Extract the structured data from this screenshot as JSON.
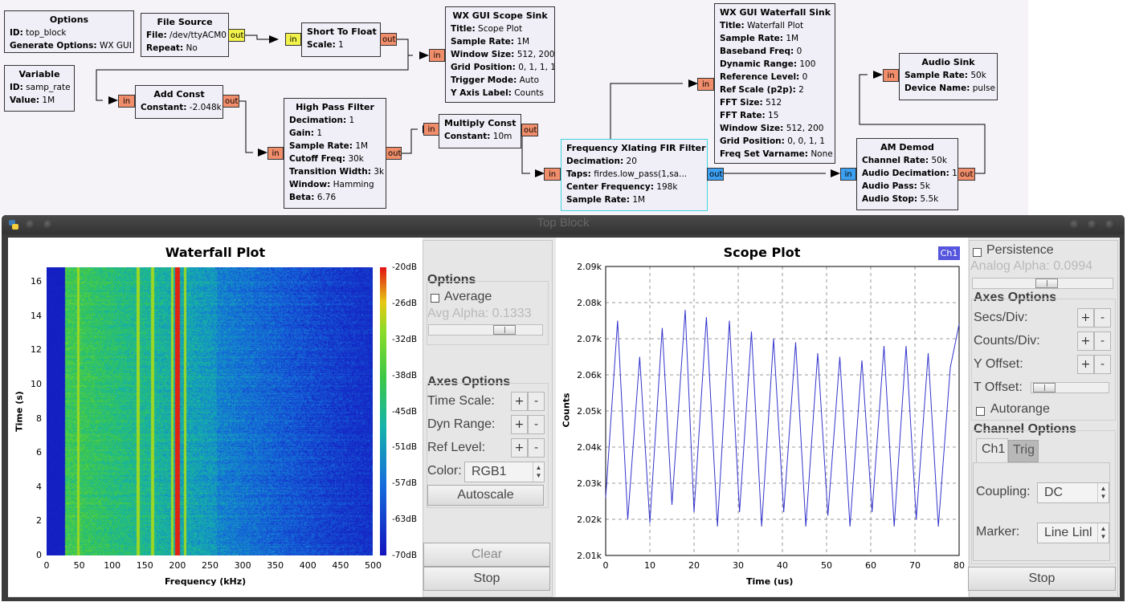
{
  "flowgraph": {
    "blocks": {
      "options": {
        "title": "Options",
        "rows": [
          [
            "ID:",
            "top_block"
          ],
          [
            "Generate Options:",
            "WX GUI"
          ]
        ]
      },
      "variable": {
        "title": "Variable",
        "rows": [
          [
            "ID:",
            "samp_rate"
          ],
          [
            "Value:",
            "1M"
          ]
        ]
      },
      "file_source": {
        "title": "File Source",
        "rows": [
          [
            "File:",
            "/dev/ttyACM0"
          ],
          [
            "Repeat:",
            "No"
          ]
        ]
      },
      "short_to_float": {
        "title": "Short To Float",
        "rows": [
          [
            "Scale:",
            "1"
          ]
        ]
      },
      "add_const": {
        "title": "Add Const",
        "rows": [
          [
            "Constant:",
            "-2.048k"
          ]
        ]
      },
      "scope_sink": {
        "title": "WX GUI Scope Sink",
        "rows": [
          [
            "Title:",
            "Scope Plot"
          ],
          [
            "Sample Rate:",
            "1M"
          ],
          [
            "Window Size:",
            "512, 200"
          ],
          [
            "Grid Position:",
            "0, 1, 1, 1"
          ],
          [
            "Trigger Mode:",
            "Auto"
          ],
          [
            "Y Axis Label:",
            "Counts"
          ]
        ]
      },
      "high_pass": {
        "title": "High Pass Filter",
        "rows": [
          [
            "Decimation:",
            "1"
          ],
          [
            "Gain:",
            "1"
          ],
          [
            "Sample Rate:",
            "1M"
          ],
          [
            "Cutoff Freq:",
            "30k"
          ],
          [
            "Transition Width:",
            "3k"
          ],
          [
            "Window:",
            "Hamming"
          ],
          [
            "Beta:",
            "6.76"
          ]
        ]
      },
      "multiply_const": {
        "title": "Multiply Const",
        "rows": [
          [
            "Constant:",
            "10m"
          ]
        ]
      },
      "xlating": {
        "title": "Frequency Xlating FIR Filter",
        "rows": [
          [
            "Decimation:",
            "20"
          ],
          [
            "Taps:",
            "firdes.low_pass(1,sa..."
          ],
          [
            "Center Frequency:",
            "198k"
          ],
          [
            "Sample Rate:",
            "1M"
          ]
        ]
      },
      "waterfall_sink": {
        "title": "WX GUI Waterfall Sink",
        "rows": [
          [
            "Title:",
            "Waterfall Plot"
          ],
          [
            "Sample Rate:",
            "1M"
          ],
          [
            "Baseband Freq:",
            "0"
          ],
          [
            "Dynamic Range:",
            "100"
          ],
          [
            "Reference Level:",
            "0"
          ],
          [
            "Ref Scale (p2p):",
            "2"
          ],
          [
            "FFT Size:",
            "512"
          ],
          [
            "FFT Rate:",
            "15"
          ],
          [
            "Window Size:",
            "512, 200"
          ],
          [
            "Grid Position:",
            "0, 0, 1, 1"
          ],
          [
            "Freq Set Varname:",
            "None"
          ]
        ]
      },
      "audio_sink": {
        "title": "Audio Sink",
        "rows": [
          [
            "Sample Rate:",
            "50k"
          ],
          [
            "Device Name:",
            "pulse"
          ]
        ]
      },
      "am_demod": {
        "title": "AM Demod",
        "rows": [
          [
            "Channel Rate:",
            "50k"
          ],
          [
            "Audio Decimation:",
            "1"
          ],
          [
            "Audio Pass:",
            "5k"
          ],
          [
            "Audio Stop:",
            "5.5k"
          ]
        ]
      }
    },
    "port_in": "in",
    "port_out": "out",
    "colors": {
      "port_in": "#f08d6a",
      "port_float": "#f2f24a",
      "port_complex": "#3c9ff0",
      "selected": "#3fd4e0"
    }
  },
  "window": {
    "title": "Top Block"
  },
  "waterfall": {
    "title": "Waterfall Plot",
    "ylabel": "Time (s)",
    "xlabel": "Frequency (kHz)",
    "xticks": [
      "0",
      "50",
      "100",
      "150",
      "200",
      "250",
      "300",
      "350",
      "400",
      "450",
      "500"
    ],
    "yticks": [
      "0",
      "2",
      "4",
      "6",
      "8",
      "10",
      "12",
      "14",
      "16"
    ],
    "colorbar": [
      "-20dB",
      "-26dB",
      "-32dB",
      "-38dB",
      "-45dB",
      "-51dB",
      "-57dB",
      "-63dB",
      "-70dB"
    ],
    "bright_lines_khz": [
      48,
      140,
      162,
      192,
      200,
      212
    ]
  },
  "wf_controls": {
    "options_label": "Options",
    "average_label": "Average",
    "avg_alpha_label": "Avg Alpha: 0.1333",
    "axes_label": "Axes Options",
    "time_scale": "Time Scale:",
    "dyn_range": "Dyn Range:",
    "ref_level": "Ref Level:",
    "color_label": "Color:",
    "color_value": "RGB1",
    "autoscale": "Autoscale",
    "clear": "Clear",
    "stop": "Stop",
    "plus": "+",
    "minus": "-"
  },
  "scope": {
    "title": "Scope Plot",
    "legend": "Ch1",
    "legend_color": "#5555dd",
    "trace_color": "#3333cc",
    "ylabel": "Counts",
    "xlabel": "Time (us)",
    "xticks": [
      "0",
      "10",
      "20",
      "30",
      "40",
      "50",
      "60",
      "70",
      "80"
    ],
    "yticks": [
      "2.01k",
      "2.02k",
      "2.03k",
      "2.04k",
      "2.05k",
      "2.06k",
      "2.07k",
      "2.08k",
      "2.09k"
    ]
  },
  "chart_data": {
    "type": "line",
    "title": "Scope Plot",
    "xlabel": "Time (us)",
    "ylabel": "Counts",
    "xlim": [
      0,
      80
    ],
    "ylim": [
      2010,
      2090
    ],
    "grid": true,
    "series": [
      {
        "name": "Ch1",
        "x": [
          0,
          2.7,
          5,
          7.7,
          10,
          12.8,
          15,
          18,
          20,
          22.8,
          25.3,
          28,
          30.3,
          33,
          35.3,
          38,
          40.3,
          43,
          45.3,
          48,
          50.3,
          53,
          55.3,
          58,
          60.3,
          63,
          65.3,
          68,
          70.3,
          73,
          75.3,
          78,
          80
        ],
        "values": [
          2026,
          2075,
          2020,
          2065,
          2019,
          2073,
          2024,
          2078,
          2022,
          2076,
          2018,
          2075,
          2022,
          2072,
          2018,
          2070,
          2022,
          2069,
          2018,
          2066,
          2021,
          2065,
          2018,
          2064,
          2022,
          2068,
          2018,
          2068,
          2020,
          2066,
          2018,
          2062,
          2074
        ]
      }
    ]
  },
  "scope_controls": {
    "persistence": "Persistence",
    "analog_alpha": "Analog Alpha: 0.0994",
    "axes_label": "Axes Options",
    "secs_div": "Secs/Div:",
    "counts_div": "Counts/Div:",
    "y_offset": "Y Offset:",
    "t_offset": "T Offset:",
    "autorange": "Autorange",
    "channel_label": "Channel Options",
    "tab_ch1": "Ch1",
    "tab_trig": "Trig",
    "coupling_label": "Coupling:",
    "coupling_value": "DC",
    "marker_label": "Marker:",
    "marker_value": "Line Linl",
    "stop": "Stop",
    "plus": "+",
    "minus": "-"
  }
}
